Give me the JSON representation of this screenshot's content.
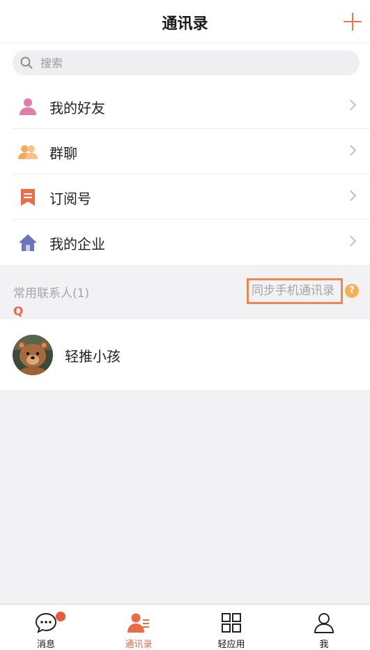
{
  "header": {
    "title": "通讯录",
    "add_icon": "plus-icon"
  },
  "search": {
    "placeholder": "搜索",
    "value": "",
    "icon": "search-icon"
  },
  "menu": [
    {
      "label": "我的好友",
      "icon": "person-icon",
      "color": "#e27fa8"
    },
    {
      "label": "群聊",
      "icon": "group-icon",
      "color": "#f5a95b"
    },
    {
      "label": "订阅号",
      "icon": "bookmark-icon",
      "color": "#ec6b45"
    },
    {
      "label": "我的企业",
      "icon": "house-icon",
      "color": "#6b74bd"
    }
  ],
  "frequent_contacts": {
    "title": "常用联系人(1)",
    "sync_label": "同步手机通讯录",
    "help_label": "?",
    "index_letter": "Q",
    "contacts": [
      {
        "name": "轻推小孩",
        "avatar": "teddy-bear-avatar"
      }
    ]
  },
  "tabbar": {
    "tabs": [
      {
        "label": "消息",
        "icon": "chat-bubble-icon",
        "active": false,
        "badge": true
      },
      {
        "label": "通讯录",
        "icon": "contacts-icon",
        "active": true,
        "badge": false
      },
      {
        "label": "轻应用",
        "icon": "apps-grid-icon",
        "active": false,
        "badge": false
      },
      {
        "label": "我",
        "icon": "profile-icon",
        "active": false,
        "badge": false
      }
    ]
  },
  "colors": {
    "accent": "#ec6b45",
    "highlight_border": "#f0874a",
    "badge": "#e8593b"
  }
}
